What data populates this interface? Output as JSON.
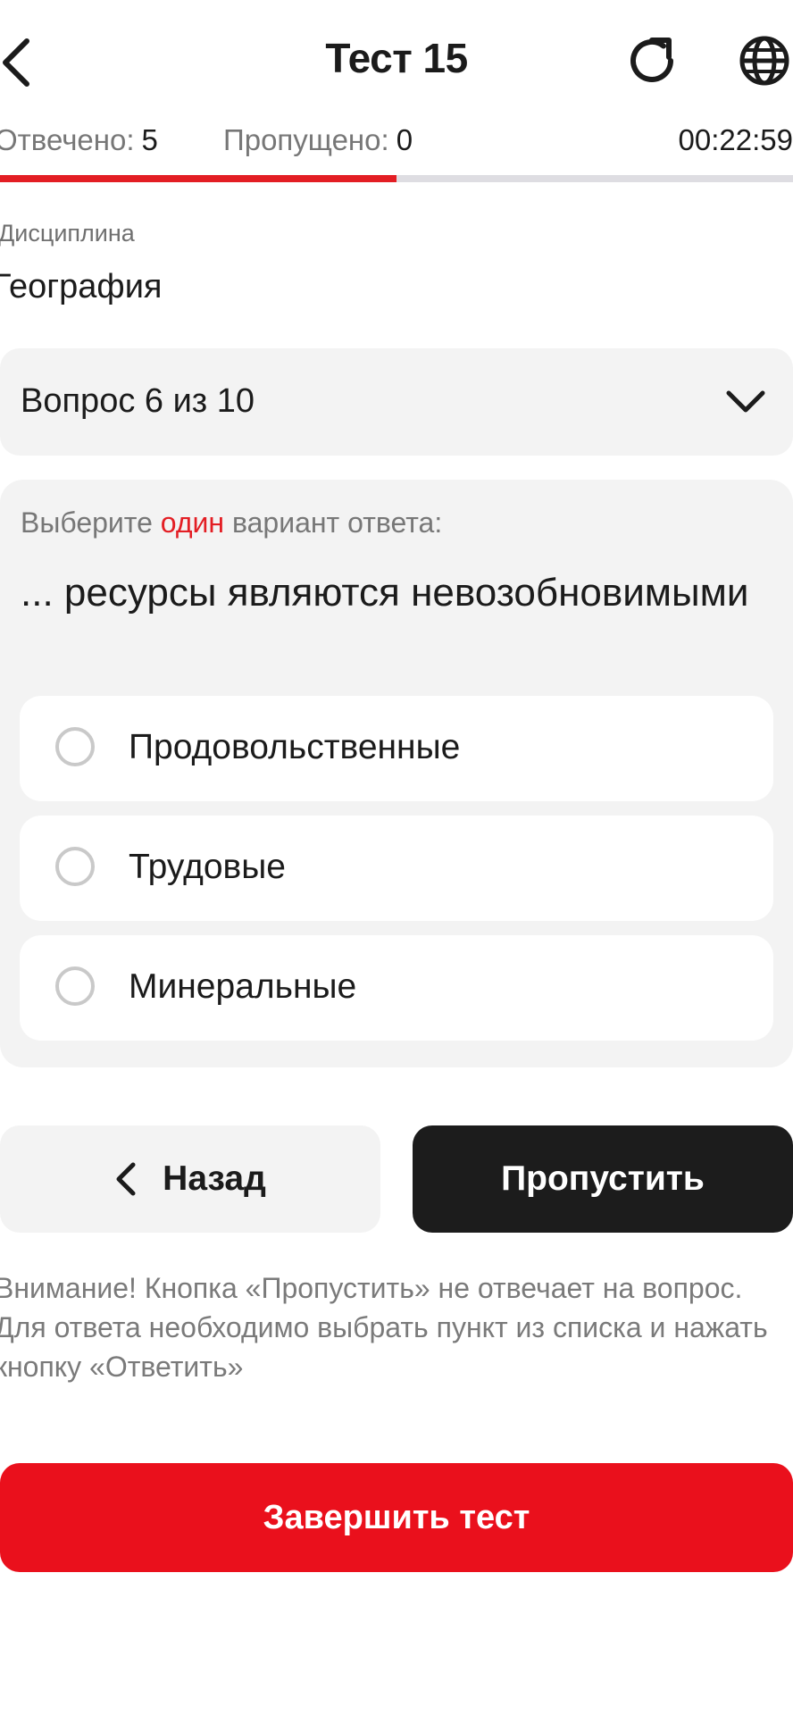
{
  "header": {
    "title": "Тест 15",
    "back_icon": "chevron-left-icon",
    "refresh_icon": "refresh-icon",
    "language_icon": "globe-icon"
  },
  "stats": {
    "answered_label": "Отвечено:",
    "answered_value": "5",
    "skipped_label": "Пропущено:",
    "skipped_value": "0",
    "timer": "00:22:59",
    "progress_fraction": 0.5
  },
  "discipline": {
    "label": "Дисциплина",
    "value": "География"
  },
  "question_selector": {
    "label": "Вопрос 6 из 10",
    "icon": "chevron-down-icon"
  },
  "question": {
    "hint_prefix": "Выберите ",
    "hint_accent": "один",
    "hint_suffix": " вариант ответа:",
    "text": "... ресурсы являются невозобновимыми",
    "options": [
      {
        "label": "Продовольственные",
        "selected": false
      },
      {
        "label": "Трудовые",
        "selected": false
      },
      {
        "label": "Минеральные",
        "selected": false
      }
    ]
  },
  "actions": {
    "back_label": "Назад",
    "skip_label": "Пропустить",
    "finish_label": "Завершить тест"
  },
  "notice": {
    "text": "Внимание! Кнопка «Пропустить» не отвечает на вопрос. Для ответа необходимо выбрать пункт из списка и нажать кнопку «Ответить»"
  },
  "colors": {
    "accent": "#e31e24",
    "finish_button": "#ea101c",
    "dark_button": "#1c1c1c",
    "surface": "#f3f3f3"
  }
}
